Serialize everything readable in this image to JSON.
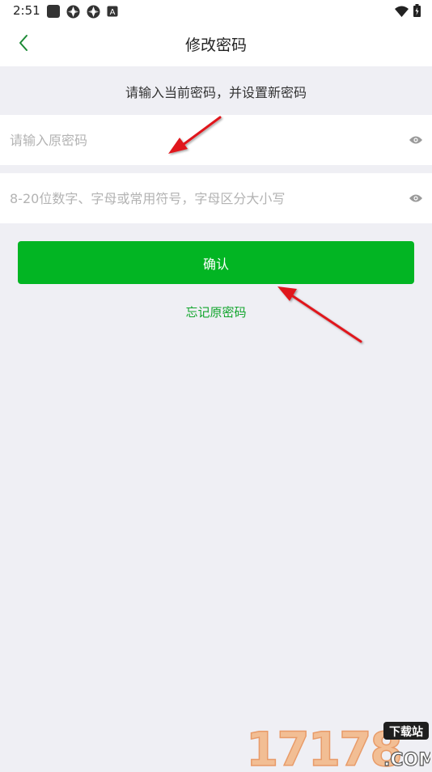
{
  "status_bar": {
    "time": "2:51",
    "left_icons": [
      "app-square-icon",
      "spinner-icon",
      "spinner-icon",
      "a-badge-icon"
    ],
    "right_icons": [
      "wifi-icon",
      "battery-icon"
    ]
  },
  "app_bar": {
    "title": "修改密码",
    "back_icon": "chevron-left-icon"
  },
  "instruction": "请输入当前密码，并设置新密码",
  "old_password": {
    "placeholder": "请输入原密码",
    "value": ""
  },
  "new_password": {
    "placeholder": "8-20位数字、字母或常用符号，字母区分大小写",
    "value": ""
  },
  "confirm_button": "确认",
  "forgot_link": "忘记原密码",
  "watermark": {
    "number": "17178",
    "badge": "下载站",
    "domain": ".COM"
  },
  "colors": {
    "accent": "#02b523",
    "link": "#11a52c",
    "background": "#efeff4",
    "annotation_arrow": "#e0191f"
  }
}
